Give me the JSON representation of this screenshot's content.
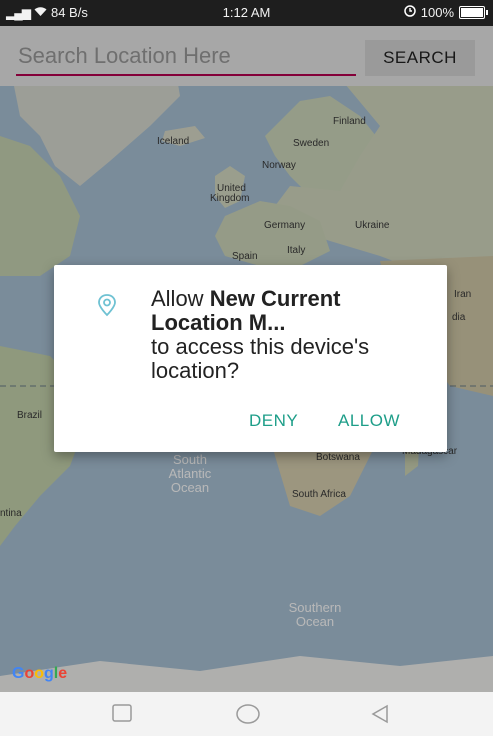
{
  "status_bar": {
    "signal": "὏6",
    "net_speed": "84 B/s",
    "time": "1:12 AM",
    "battery": "100%"
  },
  "search": {
    "placeholder": "Search Location Here",
    "button_label": "SEARCH"
  },
  "map": {
    "labels": {
      "iceland": "Iceland",
      "finland": "Finland",
      "sweden": "Sweden",
      "norway": "Norway",
      "united_kingdom_1": "United",
      "united_kingdom_2": "Kingdom",
      "germany": "Germany",
      "ukraine": "Ukraine",
      "spain": "Spain",
      "italy": "Italy",
      "iran": "Iran",
      "india_partial": "dia",
      "brazil": "Brazil",
      "botswana": "Botswana",
      "madagascar": "Madagascar",
      "south_africa": "South Africa",
      "argentina_partial": "ntina"
    },
    "oceans": {
      "south_atlantic_1": "South",
      "south_atlantic_2": "Atlantic",
      "south_atlantic_3": "Ocean",
      "southern_1": "Southern",
      "southern_2": "Ocean"
    },
    "google_logo": "Google"
  },
  "dialog": {
    "text_prefix": "Allow ",
    "app_name": "New Current Location M...",
    "text_suffix": "to access this device's location?",
    "deny_label": "DENY",
    "allow_label": "ALLOW",
    "accent_color": "#1e9e89"
  },
  "nav_bar": {
    "recents": "square-icon",
    "home": "circle-icon",
    "back": "triangle-back-icon"
  }
}
